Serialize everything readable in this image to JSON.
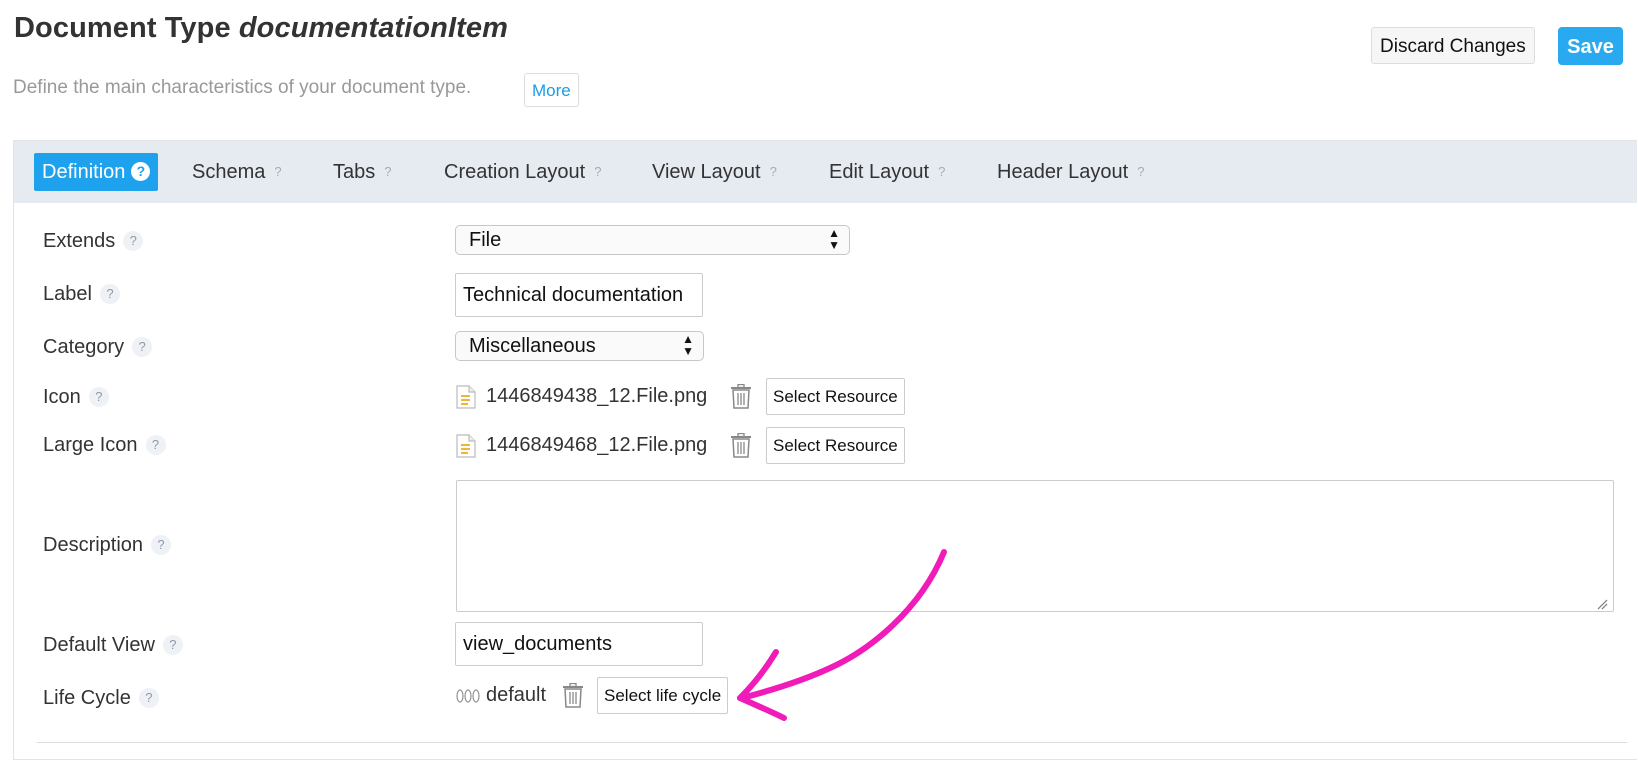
{
  "header": {
    "title_prefix": "Document Type ",
    "title_name": "documentationItem",
    "subtitle": "Define the main characteristics of your document type.",
    "more_label": "More",
    "discard_label": "Discard Changes",
    "save_label": "Save"
  },
  "tabs": [
    {
      "label": "Definition",
      "active": true
    },
    {
      "label": "Schema"
    },
    {
      "label": "Tabs"
    },
    {
      "label": "Creation Layout"
    },
    {
      "label": "View Layout"
    },
    {
      "label": "Edit Layout"
    },
    {
      "label": "Header Layout"
    }
  ],
  "help_glyph": "?",
  "fields": {
    "extends": {
      "label": "Extends",
      "value": "File"
    },
    "label": {
      "label": "Label",
      "value": "Technical documentation"
    },
    "category": {
      "label": "Category",
      "value": "Miscellaneous"
    },
    "icon": {
      "label": "Icon",
      "file": "1446849438_12.File.png",
      "button": "Select Resource"
    },
    "large_icon": {
      "label": "Large Icon",
      "file": "1446849468_12.File.png",
      "button": "Select Resource"
    },
    "description": {
      "label": "Description",
      "value": ""
    },
    "default_view": {
      "label": "Default View",
      "value": "view_documents"
    },
    "life_cycle": {
      "label": "Life Cycle",
      "value": "default",
      "button": "Select life cycle"
    }
  },
  "colors": {
    "accent": "#1fa2ee",
    "save": "#29aaf0",
    "annotation_arrow": "#f01bb8"
  }
}
